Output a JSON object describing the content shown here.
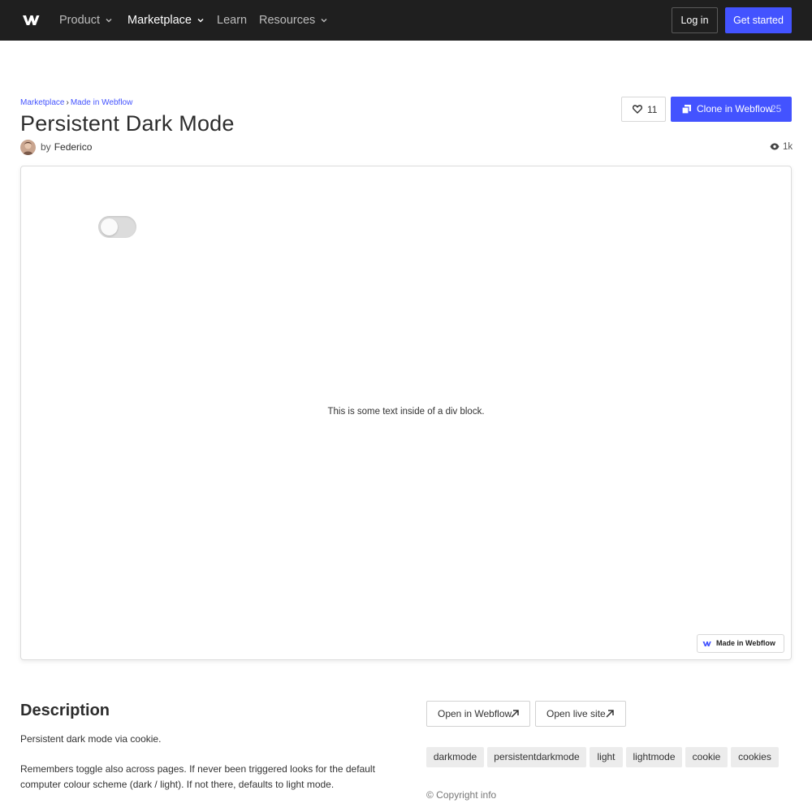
{
  "nav": {
    "items": [
      {
        "label": "Product",
        "has_menu": true
      },
      {
        "label": "Marketplace",
        "has_menu": true
      },
      {
        "label": "Learn",
        "has_menu": false
      },
      {
        "label": "Resources",
        "has_menu": true
      }
    ],
    "login_label": "Log in",
    "get_started_label": "Get started"
  },
  "header": {
    "breadcrumb": [
      "Marketplace",
      "Made in Webflow"
    ],
    "breadcrumb_separator": "›",
    "title": "Persistent Dark Mode",
    "author_prefix": "by",
    "author": "Federico",
    "likes": "11",
    "clone_label": "Clone in Webflow",
    "clone_count": "25",
    "views": "1k"
  },
  "preview": {
    "toggle_state": "off",
    "text": "This is some text inside of a div block.",
    "badge_label": "Made in Webflow"
  },
  "description": {
    "title": "Description",
    "paragraphs": [
      "Persistent dark mode via cookie.",
      "Remembers toggle also across pages. If never been triggered looks for the default computer colour scheme (dark / light). If not there, defaults to light mode."
    ]
  },
  "actions": {
    "open_webflow": "Open in Webflow",
    "open_live": "Open live site"
  },
  "tags": [
    "darkmode",
    "persistentdarkmode",
    "light",
    "lightmode",
    "cookie",
    "cookies"
  ],
  "copyright": "© Copyright info",
  "colors": {
    "nav_bg": "#1f1f1f",
    "accent": "#4353ff",
    "tag_bg": "#ececec"
  }
}
